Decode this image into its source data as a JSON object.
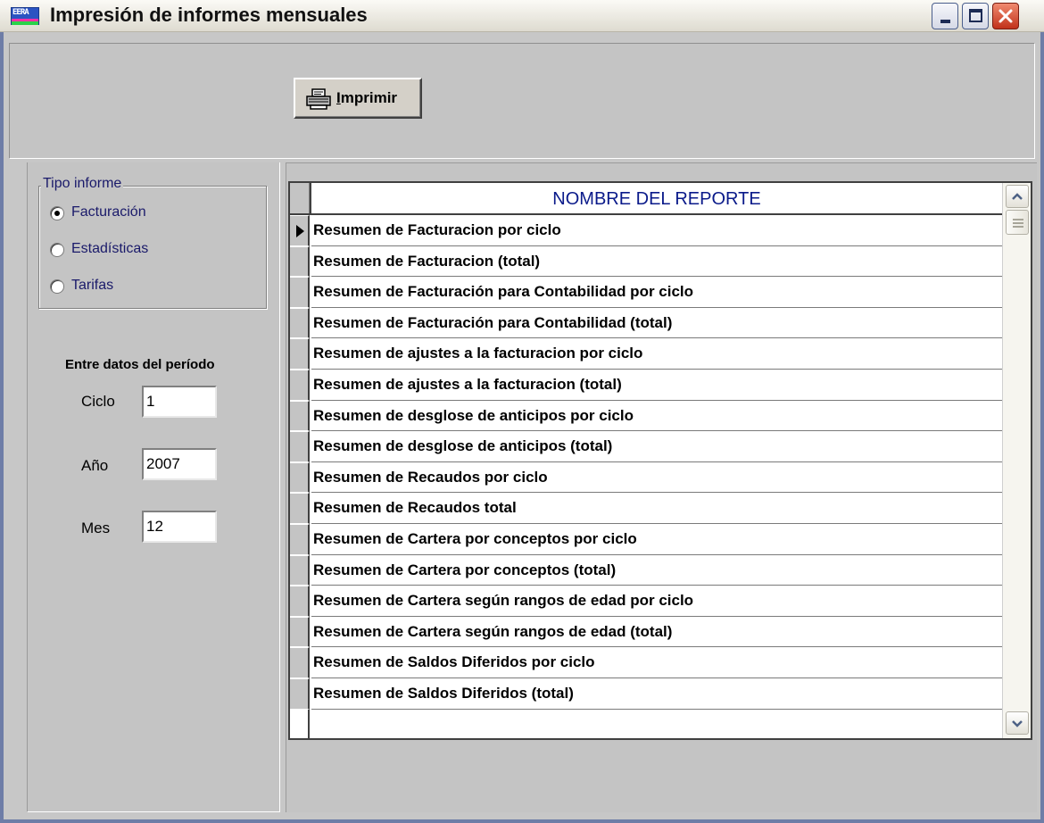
{
  "window": {
    "title": "Impresión de informes mensuales",
    "accent_color": "#0a246a"
  },
  "toolbar": {
    "print_label_underlined": "I",
    "print_label_rest": "mprimir",
    "print_icon": "printer-icon"
  },
  "report_type": {
    "legend": "Tipo informe",
    "options": [
      {
        "label": "Facturación",
        "selected": true
      },
      {
        "label": "Estadísticas",
        "selected": false
      },
      {
        "label": "Tarifas",
        "selected": false
      }
    ]
  },
  "period": {
    "title": "Entre datos del período",
    "cycle_label": "Ciclo",
    "cycle_value": "1",
    "year_label": "Año",
    "year_value": "2007",
    "month_label": "Mes",
    "month_value": "12"
  },
  "grid": {
    "column_header": "NOMBRE  DEL  REPORTE",
    "current_row_index": 0,
    "rows": [
      "Resumen de Facturacion por ciclo",
      "Resumen de Facturacion (total)",
      "Resumen de Facturación para Contabilidad por ciclo",
      "Resumen de Facturación para Contabilidad (total)",
      "Resumen de ajustes a la facturacion por ciclo",
      "Resumen de ajustes a la facturacion (total)",
      "Resumen de desglose de anticipos por ciclo",
      "Resumen de desglose de anticipos (total)",
      "Resumen de Recaudos por ciclo",
      "Resumen de Recaudos total",
      "Resumen de Cartera por conceptos por ciclo",
      "Resumen de Cartera por conceptos (total)",
      "Resumen de Cartera según rangos de edad por ciclo",
      "Resumen de Cartera según rangos de edad (total)",
      "Resumen de Saldos Diferidos por ciclo",
      "Resumen de Saldos Diferidos (total)"
    ]
  }
}
